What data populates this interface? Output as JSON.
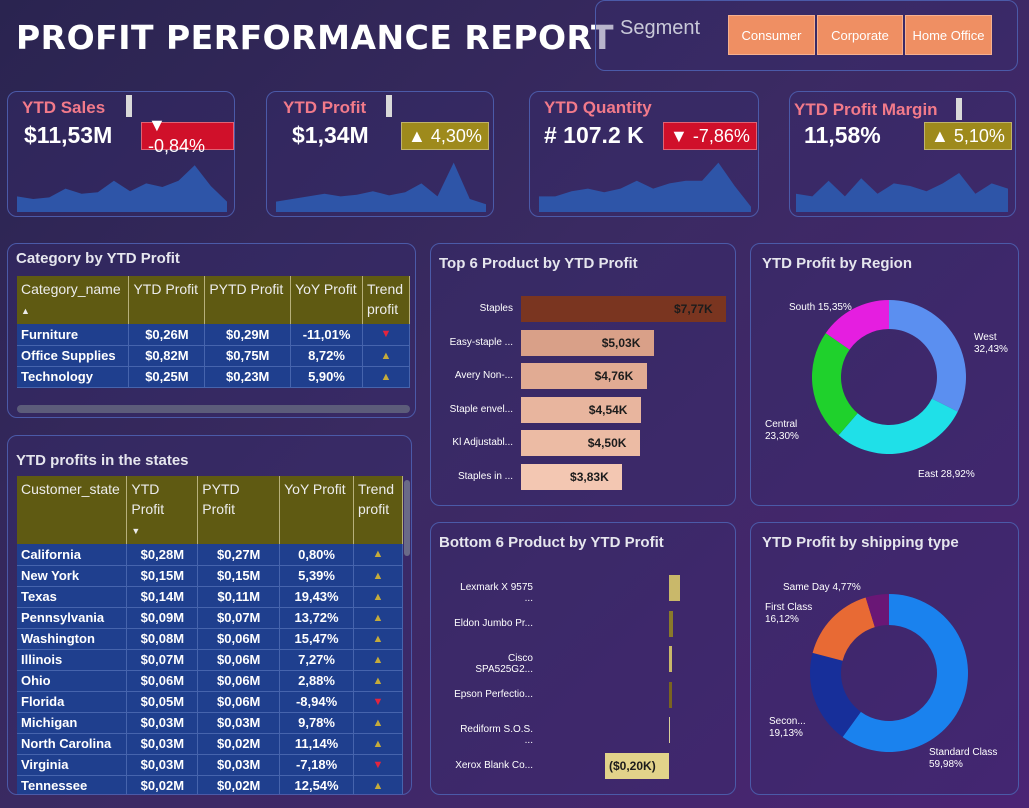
{
  "header": {
    "title": "PROFIT PERFORMANCE REPORT"
  },
  "segment": {
    "label": "Segment",
    "options": [
      "Consumer",
      "Corporate",
      "Home Office"
    ]
  },
  "kpis": [
    {
      "title": "YTD Sales",
      "value": "$11,53M",
      "change": "▼ -0,84%",
      "trend": "down",
      "spark": [
        0.3,
        0.25,
        0.28,
        0.45,
        0.35,
        0.38,
        0.6,
        0.4,
        0.55,
        0.48,
        0.6,
        0.9,
        0.5,
        0.2
      ]
    },
    {
      "title": "YTD Profit",
      "value": "$1,34M",
      "change": "▲ 4,30%",
      "trend": "up",
      "spark": [
        0.2,
        0.25,
        0.3,
        0.35,
        0.3,
        0.33,
        0.4,
        0.32,
        0.38,
        0.55,
        0.3,
        0.95,
        0.25,
        0.15
      ]
    },
    {
      "title": "YTD Quantity",
      "value": "# 107.2 K",
      "change": "▼ -7,86%",
      "trend": "down",
      "spark": [
        0.3,
        0.3,
        0.4,
        0.45,
        0.38,
        0.45,
        0.6,
        0.45,
        0.55,
        0.6,
        0.6,
        0.95,
        0.5,
        0.1
      ]
    },
    {
      "title": "YTD Profit Margin",
      "value": "11,58%",
      "change": "▲ 5,10%",
      "trend": "up",
      "spark": [
        0.35,
        0.3,
        0.6,
        0.3,
        0.65,
        0.35,
        0.55,
        0.5,
        0.4,
        0.55,
        0.75,
        0.35,
        0.55,
        0.45
      ]
    }
  ],
  "category_table": {
    "title": "Category by YTD Profit",
    "headers": [
      "Category_name",
      "YTD Profit",
      "PYTD Profit",
      "YoY Profit",
      "Trend profit"
    ],
    "rows": [
      {
        "name": "Furniture",
        "ytd": "$0,26M",
        "pytd": "$0,29M",
        "yoy": "-11,01%",
        "trend": "down"
      },
      {
        "name": "Office Supplies",
        "ytd": "$0,82M",
        "pytd": "$0,75M",
        "yoy": "8,72%",
        "trend": "up"
      },
      {
        "name": "Technology",
        "ytd": "$0,25M",
        "pytd": "$0,23M",
        "yoy": "5,90%",
        "trend": "up"
      }
    ]
  },
  "states_table": {
    "title": "YTD profits in the states",
    "headers": [
      "Customer_state",
      "YTD Profit",
      "PYTD Profit",
      "YoY Profit",
      "Trend profit"
    ],
    "rows": [
      {
        "name": "California",
        "ytd": "$0,28M",
        "pytd": "$0,27M",
        "yoy": "0,80%",
        "trend": "up"
      },
      {
        "name": "New York",
        "ytd": "$0,15M",
        "pytd": "$0,15M",
        "yoy": "5,39%",
        "trend": "up"
      },
      {
        "name": "Texas",
        "ytd": "$0,14M",
        "pytd": "$0,11M",
        "yoy": "19,43%",
        "trend": "up"
      },
      {
        "name": "Pennsylvania",
        "ytd": "$0,09M",
        "pytd": "$0,07M",
        "yoy": "13,72%",
        "trend": "up"
      },
      {
        "name": "Washington",
        "ytd": "$0,08M",
        "pytd": "$0,06M",
        "yoy": "15,47%",
        "trend": "up"
      },
      {
        "name": "Illinois",
        "ytd": "$0,07M",
        "pytd": "$0,06M",
        "yoy": "7,27%",
        "trend": "up"
      },
      {
        "name": "Ohio",
        "ytd": "$0,06M",
        "pytd": "$0,06M",
        "yoy": "2,88%",
        "trend": "up"
      },
      {
        "name": "Florida",
        "ytd": "$0,05M",
        "pytd": "$0,06M",
        "yoy": "-8,94%",
        "trend": "down"
      },
      {
        "name": "Michigan",
        "ytd": "$0,03M",
        "pytd": "$0,03M",
        "yoy": "9,78%",
        "trend": "up"
      },
      {
        "name": "North Carolina",
        "ytd": "$0,03M",
        "pytd": "$0,02M",
        "yoy": "11,14%",
        "trend": "up"
      },
      {
        "name": "Virginia",
        "ytd": "$0,03M",
        "pytd": "$0,03M",
        "yoy": "-7,18%",
        "trend": "down"
      },
      {
        "name": "Tennessee",
        "ytd": "$0,02M",
        "pytd": "$0,02M",
        "yoy": "12,54%",
        "trend": "up"
      }
    ]
  },
  "chart_data": [
    {
      "type": "bar",
      "title": "Top 6 Product by YTD Profit",
      "categories": [
        "Staples",
        "Easy-staple ...",
        "Avery Non-...",
        "Staple envel...",
        "Kl Adjustabl...",
        "Staples in ..."
      ],
      "values": [
        7.77,
        5.03,
        4.76,
        4.54,
        4.5,
        3.83
      ],
      "labels": [
        "$7,77K",
        "$5,03K",
        "$4,76K",
        "$4,54K",
        "$4,50K",
        "$3,83K"
      ],
      "colors": [
        "#7a3520",
        "#d9a088",
        "#e1ab93",
        "#e8b59e",
        "#ecbba4",
        "#f3c7b2"
      ]
    },
    {
      "type": "bar",
      "title": "Bottom 6 Product by YTD Profit",
      "categories": [
        "Lexmark X 9575 ...",
        "Eldon Jumbo Pr...",
        "Cisco SPA525G2...",
        "Epson Perfectio...",
        "Rediform S.O.S. ...",
        "Xerox Blank Co..."
      ],
      "values": [
        0.035,
        0.014,
        0.008,
        0.008,
        0.001,
        -0.2
      ],
      "labels": [
        "",
        "",
        "",
        "",
        "",
        "($0,20K)"
      ],
      "colors": [
        "#c9b86a",
        "#8a7a2a",
        "#c9b86a",
        "#7a6420",
        "#d8cf9a",
        "#e2d38a"
      ]
    },
    {
      "type": "pie",
      "title": "YTD Profit by Region",
      "slices": [
        {
          "name": "West",
          "value": 32.43,
          "label": "West\n32,43%",
          "color": "#5b8ff0"
        },
        {
          "name": "East",
          "value": 28.92,
          "label": "East 28,92%",
          "color": "#1fe0e8"
        },
        {
          "name": "Central",
          "value": 23.3,
          "label": "Central\n23,30%",
          "color": "#1fd12c"
        },
        {
          "name": "South",
          "value": 15.35,
          "label": "South 15,35%",
          "color": "#e51ee0"
        }
      ]
    },
    {
      "type": "pie",
      "title": "YTD Profit by shipping type",
      "slices": [
        {
          "name": "Standard Class",
          "value": 59.98,
          "label": "Standard Class\n59,98%",
          "color": "#1a82ee"
        },
        {
          "name": "Second Class",
          "value": 19.13,
          "label": "Secon...\n19,13%",
          "color": "#172f9a"
        },
        {
          "name": "First Class",
          "value": 16.12,
          "label": "First Class\n16,12%",
          "color": "#e86a34"
        },
        {
          "name": "Same Day",
          "value": 4.77,
          "label": "Same Day 4,77%",
          "color": "#6a1776"
        }
      ]
    }
  ]
}
